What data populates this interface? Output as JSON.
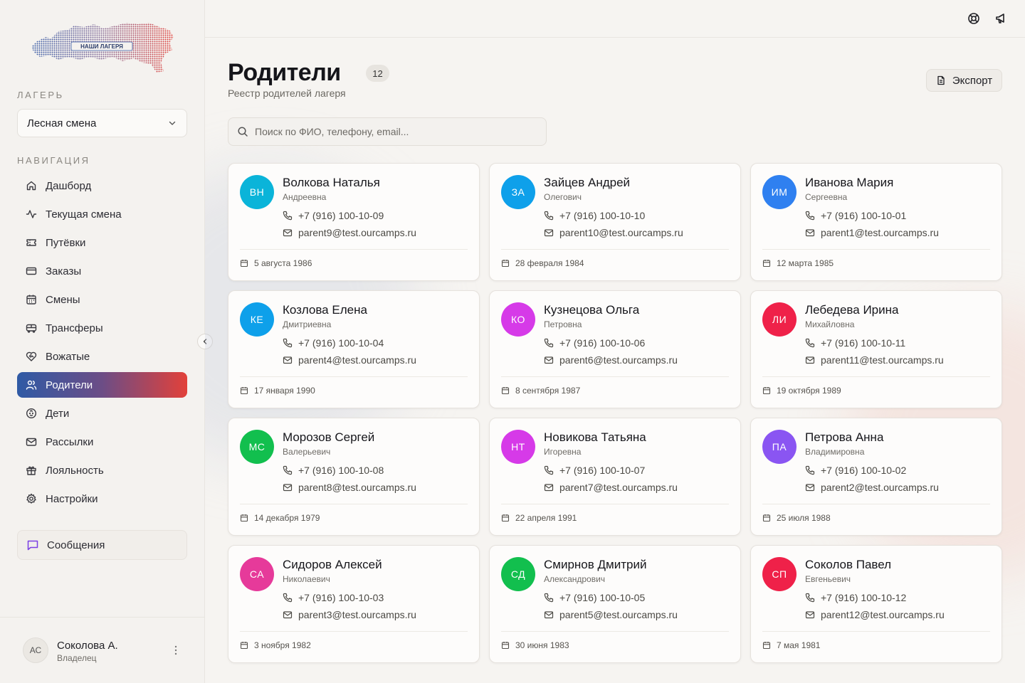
{
  "logo": {
    "text": "НАШИ ЛАГЕРЯ"
  },
  "sidebar": {
    "camp_label": "ЛАГЕРЬ",
    "camp_value": "Лесная смена",
    "nav_label": "НАВИГАЦИЯ",
    "items": [
      {
        "label": "Дашборд",
        "icon": "home-icon"
      },
      {
        "label": "Текущая смена",
        "icon": "activity-icon"
      },
      {
        "label": "Путёвки",
        "icon": "ticket-icon"
      },
      {
        "label": "Заказы",
        "icon": "credit-card-icon"
      },
      {
        "label": "Смены",
        "icon": "calendar-icon"
      },
      {
        "label": "Трансферы",
        "icon": "bus-icon"
      },
      {
        "label": "Вожатые",
        "icon": "heart-handshake-icon"
      },
      {
        "label": "Родители",
        "icon": "users-icon",
        "active": true
      },
      {
        "label": "Дети",
        "icon": "baby-icon"
      },
      {
        "label": "Рассылки",
        "icon": "mail-icon"
      },
      {
        "label": "Лояльность",
        "icon": "gift-icon"
      },
      {
        "label": "Настройки",
        "icon": "settings-icon"
      }
    ],
    "messages_label": "Сообщения",
    "user": {
      "initials": "АС",
      "name": "Соколова А.",
      "role": "Владелец"
    }
  },
  "header": {
    "title": "Родители",
    "count": "12",
    "subtitle": "Реестр родителей лагеря",
    "export_label": "Экспорт",
    "search_placeholder": "Поиск по ФИО, телефону, email..."
  },
  "colors": {
    "accent_gradient": [
      "#2f5aa5",
      "#e2413a"
    ]
  },
  "parents": [
    {
      "initials": "ВН",
      "name": "Волкова Наталья",
      "patronymic": "Андреевна",
      "phone": "+7 (916) 100-10-09",
      "email": "parent9@test.ourcamps.ru",
      "birthdate": "5 августа 1986",
      "color": "#0ab4d9"
    },
    {
      "initials": "ЗА",
      "name": "Зайцев Андрей",
      "patronymic": "Олегович",
      "phone": "+7 (916) 100-10-10",
      "email": "parent10@test.ourcamps.ru",
      "birthdate": "28 февраля 1984",
      "color": "#0ea0ea"
    },
    {
      "initials": "ИМ",
      "name": "Иванова Мария",
      "patronymic": "Сергеевна",
      "phone": "+7 (916) 100-10-01",
      "email": "parent1@test.ourcamps.ru",
      "birthdate": "12 марта 1985",
      "color": "#2f80f0"
    },
    {
      "initials": "КЕ",
      "name": "Козлова Елена",
      "patronymic": "Дмитриевна",
      "phone": "+7 (916) 100-10-04",
      "email": "parent4@test.ourcamps.ru",
      "birthdate": "17 января 1990",
      "color": "#0ea0ea"
    },
    {
      "initials": "КО",
      "name": "Кузнецова Ольга",
      "patronymic": "Петровна",
      "phone": "+7 (916) 100-10-06",
      "email": "parent6@test.ourcamps.ru",
      "birthdate": "8 сентября 1987",
      "color": "#d63ae8"
    },
    {
      "initials": "ЛИ",
      "name": "Лебедева Ирина",
      "patronymic": "Михайловна",
      "phone": "+7 (916) 100-10-11",
      "email": "parent11@test.ourcamps.ru",
      "birthdate": "19 октября 1989",
      "color": "#ef2149"
    },
    {
      "initials": "МС",
      "name": "Морозов Сергей",
      "patronymic": "Валерьевич",
      "phone": "+7 (916) 100-10-08",
      "email": "parent8@test.ourcamps.ru",
      "birthdate": "14 декабря 1979",
      "color": "#12bf4e"
    },
    {
      "initials": "НТ",
      "name": "Новикова Татьяна",
      "patronymic": "Игоревна",
      "phone": "+7 (916) 100-10-07",
      "email": "parent7@test.ourcamps.ru",
      "birthdate": "22 апреля 1991",
      "color": "#d63ae8"
    },
    {
      "initials": "ПА",
      "name": "Петрова Анна",
      "patronymic": "Владимировна",
      "phone": "+7 (916) 100-10-02",
      "email": "parent2@test.ourcamps.ru",
      "birthdate": "25 июля 1988",
      "color": "#8a55f2"
    },
    {
      "initials": "СА",
      "name": "Сидоров Алексей",
      "patronymic": "Николаевич",
      "phone": "+7 (916) 100-10-03",
      "email": "parent3@test.ourcamps.ru",
      "birthdate": "3 ноября 1982",
      "color": "#e63a9a"
    },
    {
      "initials": "СД",
      "name": "Смирнов Дмитрий",
      "patronymic": "Александрович",
      "phone": "+7 (916) 100-10-05",
      "email": "parent5@test.ourcamps.ru",
      "birthdate": "30 июня 1983",
      "color": "#12bf4e"
    },
    {
      "initials": "СП",
      "name": "Соколов Павел",
      "patronymic": "Евгеньевич",
      "phone": "+7 (916) 100-10-12",
      "email": "parent12@test.ourcamps.ru",
      "birthdate": "7 мая 1981",
      "color": "#ef2149"
    }
  ]
}
